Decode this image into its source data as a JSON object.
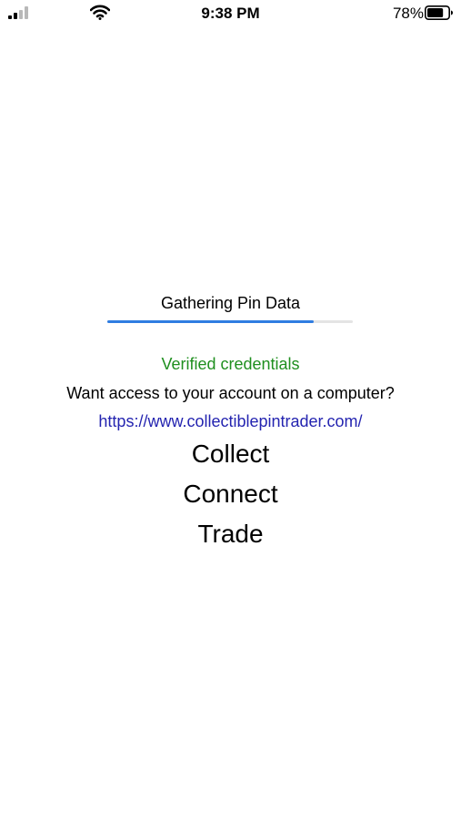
{
  "status_bar": {
    "time": "9:38 PM",
    "battery_percent": "78%",
    "battery_level": 0.78,
    "signal_icon": "cellular-signal-icon",
    "wifi_icon": "wifi-icon",
    "battery_icon": "battery-icon"
  },
  "loading": {
    "title": "Gathering Pin Data",
    "progress": 0.84,
    "fill_color": "#2f7de1",
    "track_color": "#e4e4e4"
  },
  "messages": {
    "status": "Verified credentials",
    "status_color": "#1f8f1f",
    "access_prompt": "Want access to your account on a computer?",
    "website": "https://www.collectiblepintrader.com/",
    "link_color": "#2424b0"
  },
  "taglines": [
    "Collect",
    "Connect",
    "Trade"
  ]
}
